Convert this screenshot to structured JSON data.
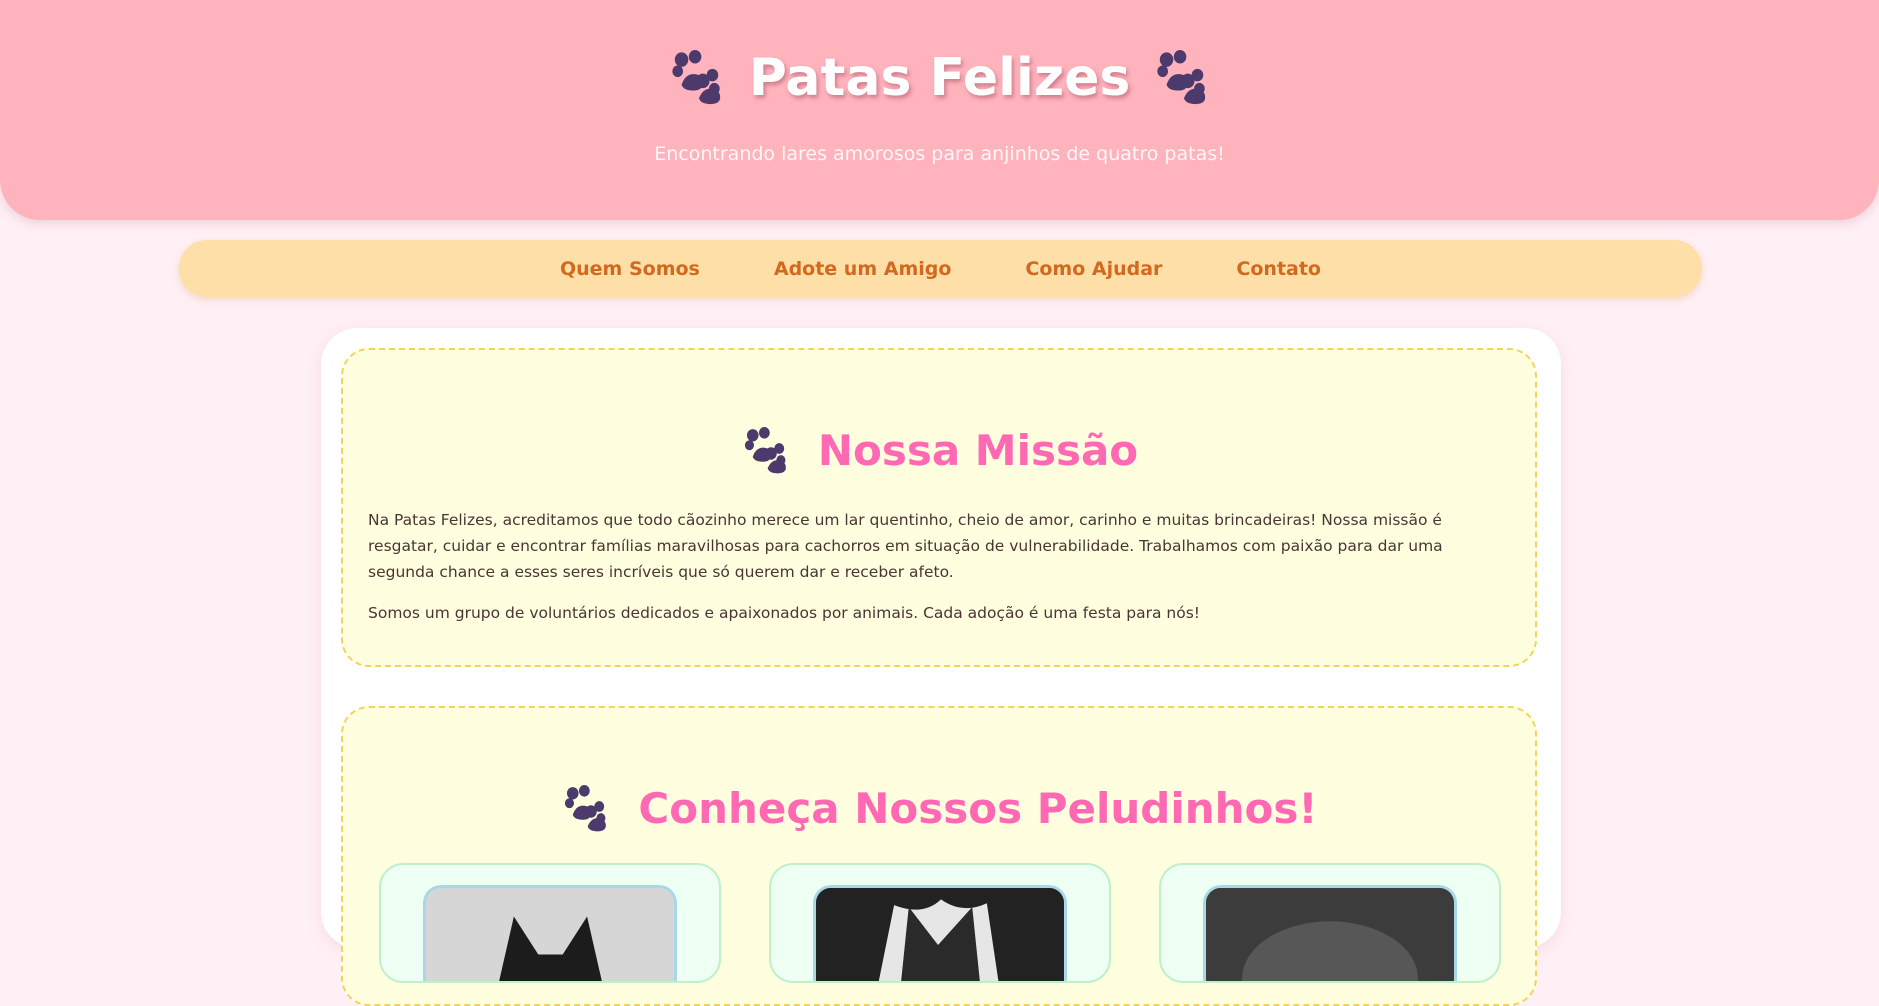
{
  "header": {
    "title": "Patas Felizes",
    "subtitle": "Encontrando lares amorosos para anjinhos de quatro patas!"
  },
  "nav": {
    "items": [
      {
        "label": "Quem Somos"
      },
      {
        "label": "Adote um Amigo"
      },
      {
        "label": "Como Ajudar"
      },
      {
        "label": "Contato"
      }
    ]
  },
  "mission": {
    "title": "Nossa Missão",
    "paragraph1": "Na Patas Felizes, acreditamos que todo cãozinho merece um lar quentinho, cheio de amor, carinho e muitas brincadeiras! Nossa missão é resgatar, cuidar e encontrar famílias maravilhosas para cachorros em situação de vulnerabilidade. Trabalhamos com paixão para dar uma segunda chance a esses seres incríveis que só querem dar e receber afeto.",
    "paragraph2": "Somos um grupo de voluntários dedicados e apaixonados por animais. Cada adoção é uma festa para nós!"
  },
  "pets": {
    "title": "Conheça Nossos Peludinhos!"
  },
  "icons": {
    "paw": "paw-print-icon",
    "pet_photo": "dog-photo"
  },
  "colors": {
    "header_bg": "#ffb3bd",
    "nav_bg": "#ffdfa8",
    "nav_text": "#d2691e",
    "heading_pink": "#ff69b4",
    "section_bg": "#ffffdf",
    "section_border": "#f2d45c",
    "page_bg": "#fff0f5"
  }
}
